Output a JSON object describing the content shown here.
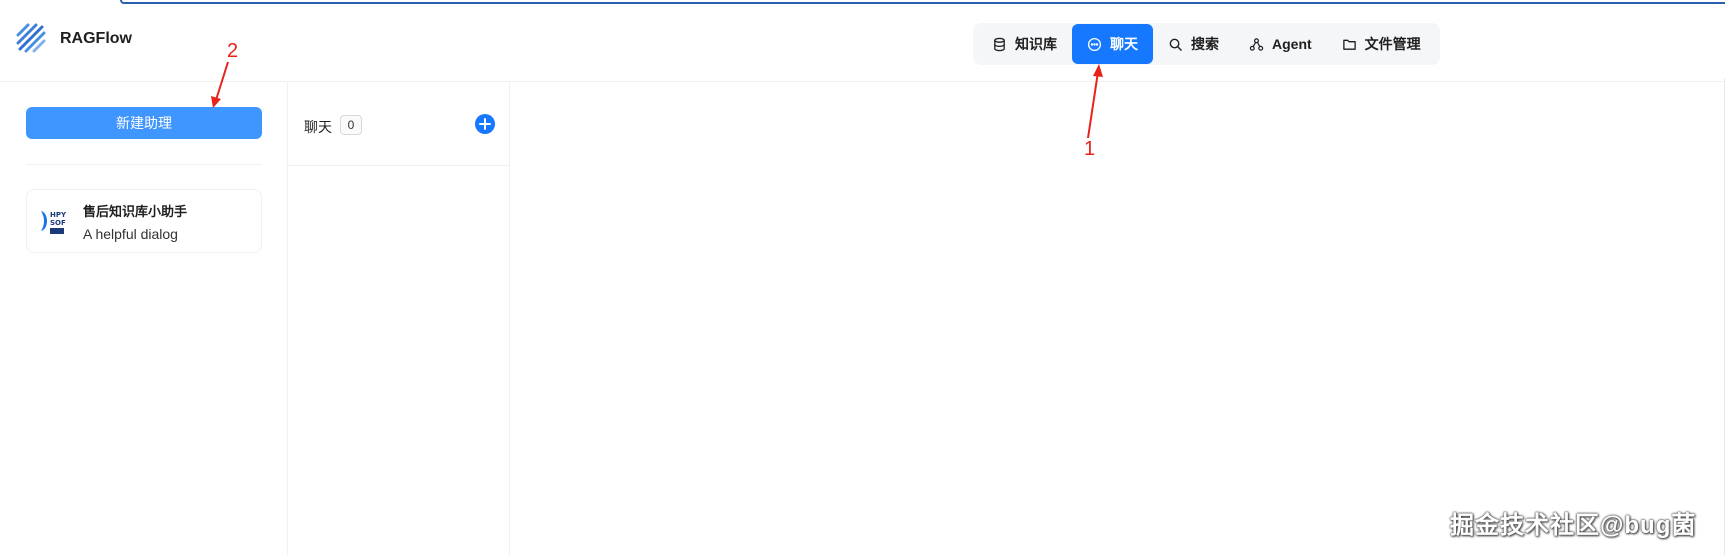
{
  "app": {
    "name": "RAGFlow"
  },
  "nav": {
    "items": [
      {
        "label": "知识库",
        "icon": "database-icon",
        "active": false
      },
      {
        "label": "聊天",
        "icon": "chat-bubble-icon",
        "active": true
      },
      {
        "label": "搜索",
        "icon": "search-icon",
        "active": false
      },
      {
        "label": "Agent",
        "icon": "agent-graph-icon",
        "active": false
      },
      {
        "label": "文件管理",
        "icon": "folder-icon",
        "active": false
      }
    ]
  },
  "assistants": {
    "new_button_label": "新建助理",
    "items": [
      {
        "name": "售后知识库小助手",
        "description": "A helpful dialog"
      }
    ]
  },
  "chats": {
    "label": "聊天",
    "count": "0"
  },
  "annotations": {
    "one": "1",
    "two": "2"
  },
  "watermark": "掘金技术社区@bug菌",
  "colors": {
    "accent": "#1677ff",
    "button": "#4096ff",
    "annotation": "#e8231b"
  }
}
